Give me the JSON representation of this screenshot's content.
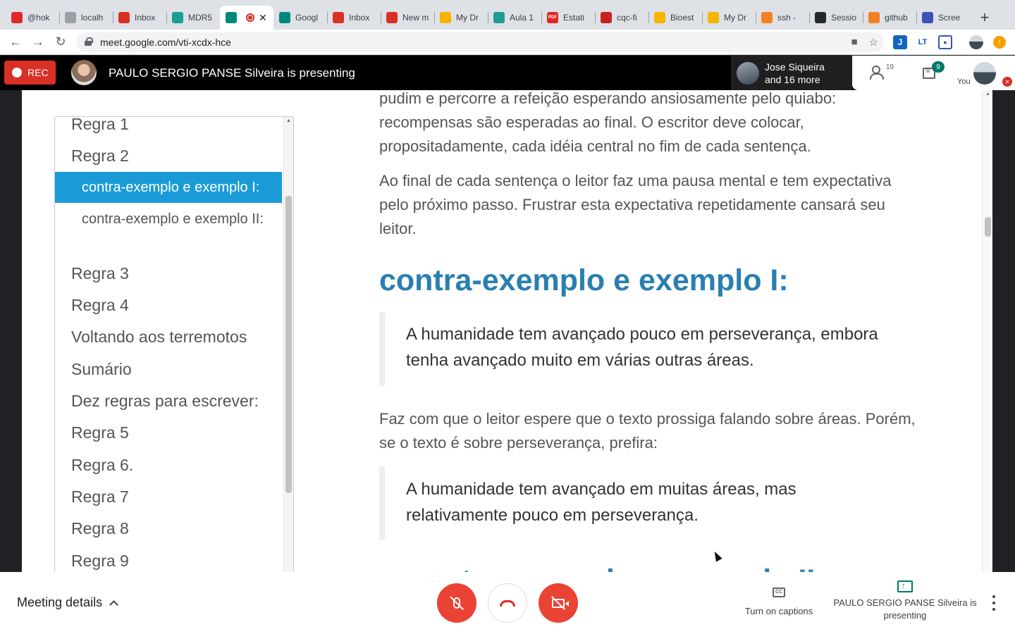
{
  "browser": {
    "tabs": [
      {
        "title": "@hok",
        "icon": "flipboard-icon",
        "color": "#e12828"
      },
      {
        "title": "localh",
        "icon": "globe-icon",
        "color": "#9aa0a6"
      },
      {
        "title": "Inbox",
        "icon": "gmail-icon",
        "color": "#d93025"
      },
      {
        "title": "MDR5",
        "icon": "classroom-icon",
        "color": "#1e9e8f"
      },
      {
        "title": "",
        "icon": "meet-icon",
        "color": "#00897b",
        "active": true
      },
      {
        "title": "Googl",
        "icon": "meet-icon",
        "color": "#00897b"
      },
      {
        "title": "Inbox",
        "icon": "gmail-icon",
        "color": "#d93025"
      },
      {
        "title": "New m",
        "icon": "gmail-icon",
        "color": "#d93025"
      },
      {
        "title": "My Dr",
        "icon": "drive-icon",
        "color": "#f4b400"
      },
      {
        "title": "Aula 1",
        "icon": "classroom-icon",
        "color": "#1e9e8f"
      },
      {
        "title": "Estati",
        "icon": "pdf-icon",
        "color": "#e12828"
      },
      {
        "title": "cqc-fi",
        "icon": "calendar-icon",
        "color": "#c5221f"
      },
      {
        "title": "Bioest",
        "icon": "drive-icon",
        "color": "#f4b400"
      },
      {
        "title": "My Dr",
        "icon": "drive-icon",
        "color": "#f4b400"
      },
      {
        "title": "ssh -",
        "icon": "stackoverflow-icon",
        "color": "#f48024"
      },
      {
        "title": "Sessio",
        "icon": "github-icon",
        "color": "#24292e"
      },
      {
        "title": "github",
        "icon": "stackoverflow-icon",
        "color": "#f48024"
      },
      {
        "title": "Scree",
        "icon": "screencast-icon",
        "color": "#3f51b5"
      }
    ],
    "new_tab_label": "+",
    "url": "meet.google.com/vti-xcdx-hce",
    "pdf_badge": "PDF",
    "ext_j": "J",
    "ext_lt": "LT"
  },
  "meet": {
    "rec_label": "REC",
    "presenting_title": "PAULO SERGIO PANSE Silveira is presenting",
    "participants_line1": "Jose Siqueira",
    "participants_line2": "and 16 more",
    "people_count": "19",
    "chat_badge": "9",
    "you_label": "You"
  },
  "toc": {
    "items": [
      {
        "label": "Regra 1"
      },
      {
        "label": "Regra 2"
      },
      {
        "label": "contra-exemplo e exemplo I:",
        "sub": true,
        "active": true
      },
      {
        "label": "contra-exemplo e exemplo II:",
        "sub": true
      },
      {
        "label": "Regra 3"
      },
      {
        "label": "Regra 4"
      },
      {
        "label": "Voltando aos terremotos"
      },
      {
        "label": "Sumário"
      },
      {
        "label": "Dez regras para escrever:"
      },
      {
        "label": "Regra 5"
      },
      {
        "label": "Regra 6."
      },
      {
        "label": "Regra 7"
      },
      {
        "label": "Regra 8"
      },
      {
        "label": "Regra 9"
      }
    ]
  },
  "content": {
    "para1": "pudim e percorre a refeição esperando ansiosamente pelo quiabo: recompensas são esperadas ao final. O escritor deve colocar, propositadamente, cada idéia central no fim de cada sentença.",
    "para2": "Ao final de cada sentença o leitor faz uma pausa mental e tem expectativa pelo próximo passo. Frustrar esta expectativa repetidamente cansará seu leitor.",
    "heading1": "contra-exemplo e exemplo I:",
    "quote1": "A humanidade tem avançado pouco em perseverança, embora tenha avançado muito em várias outras áreas.",
    "para3": "Faz com que o leitor espere que o texto prossiga falando sobre áreas. Porém, se o texto é sobre perseverança, prefira:",
    "quote2": "A humanidade tem avançado em muitas áreas, mas relativamente pouco em perseverança.",
    "heading2": "contra-exemplo e exemplo II:"
  },
  "controls": {
    "meeting_details_label": "Meeting details",
    "captions_label": "Turn on captions",
    "cc_glyph": "CC",
    "present_label": "PAULO SERGIO PANSE Silveira is presenting"
  },
  "colors": {
    "rec_red": "#d93025",
    "control_red": "#ea4335",
    "toc_active": "#1a9bd7",
    "heading_blue": "#2a7fb0",
    "meet_teal": "#00796b"
  }
}
